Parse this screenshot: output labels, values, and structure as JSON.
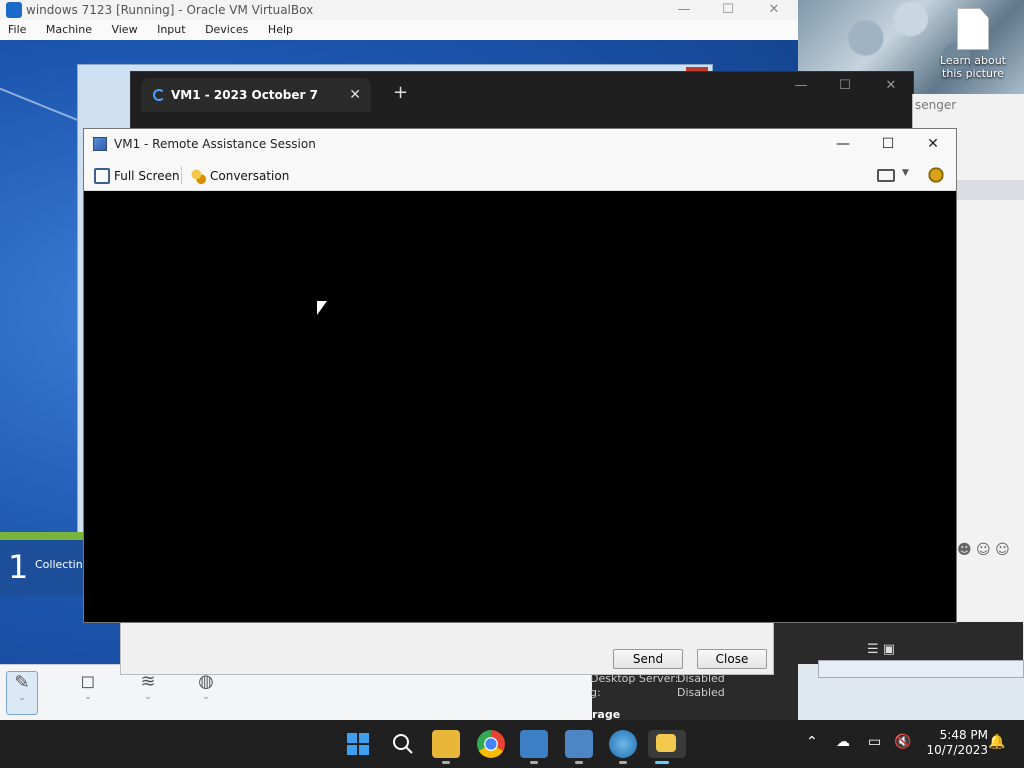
{
  "host": {
    "desktop_icon_label": "Learn about this picture"
  },
  "vbox": {
    "title": "windows 7123 [Running] - Oracle VM VirtualBox",
    "menu": [
      "File",
      "Machine",
      "View",
      "Input",
      "Devices",
      "Help"
    ]
  },
  "guest": {
    "counter_number": "1",
    "counter_text": "Collectin",
    "settings_rows": [
      {
        "label": "Desktop Server:",
        "value": "Disabled"
      },
      {
        "label": "g:",
        "value": "Disabled"
      }
    ],
    "settings_heading": "rage"
  },
  "browser": {
    "tab_title": "VM1 - 2023 October 7",
    "new_tab_symbol": "+"
  },
  "messenger": {
    "title_fragment": "senger"
  },
  "ra": {
    "title": "VM1 - Remote Assistance Session",
    "toolbar": {
      "full_screen": "Full Screen",
      "conversation": "Conversation"
    }
  },
  "chat_panel": {
    "send": "Send",
    "close": "Close"
  },
  "taskbar": {
    "time": "5:48 PM",
    "date": "10/7/2023"
  },
  "colors": {
    "taskbar_bg": "#202020",
    "accent": "#60cdff",
    "guest_desktop": "#1d56b0"
  }
}
